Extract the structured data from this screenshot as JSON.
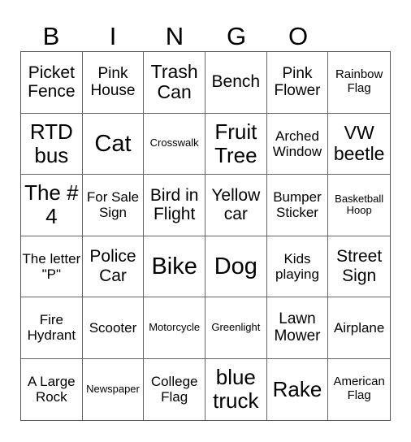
{
  "header": {
    "letters": [
      "B",
      "I",
      "N",
      "G",
      "O"
    ]
  },
  "cells": [
    [
      "Picket Fence",
      "Pink House",
      "Trash Can",
      "Bench",
      "Pink Flower",
      "Rainbow Flag"
    ],
    [
      "RTD bus",
      "Cat",
      "Crosswalk",
      "Fruit Tree",
      "Arched Window",
      "VW beetle"
    ],
    [
      "The # 4",
      "For Sale Sign",
      "Bird in Flight",
      "Yellow car",
      "Bumper Sticker",
      "Basketball Hoop"
    ],
    [
      "The letter \"P\"",
      "Police Car",
      "Bike",
      "Dog",
      "Kids playing",
      "Street Sign"
    ],
    [
      "Fire Hydrant",
      "Scooter",
      "Motorcycle",
      "Greenlight",
      "Lawn Mower",
      "Airplane"
    ],
    [
      "A Large Rock",
      "Newspaper",
      "College Flag",
      "blue truck",
      "Rake",
      "American Flag"
    ]
  ]
}
